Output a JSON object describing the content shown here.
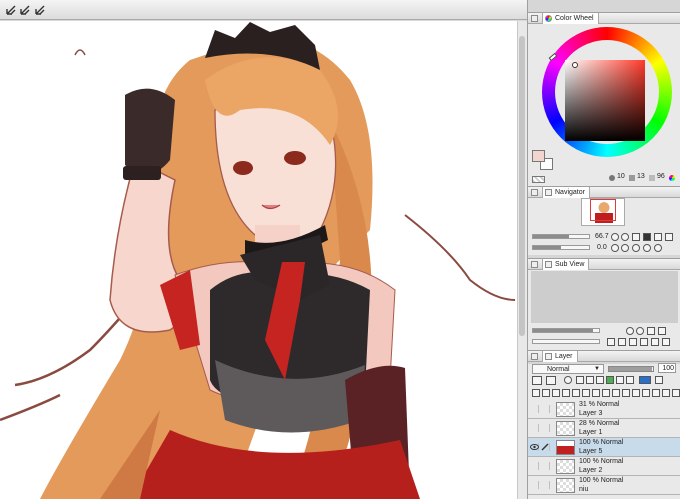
{
  "toolbar": {
    "buttons": [
      "arrow-icon",
      "arrow-icon",
      "arrow-icon"
    ]
  },
  "colors": {
    "main": "#f3d5cf",
    "sub": "#ffffff",
    "readout": {
      "h": "10",
      "s": "13",
      "v": "96"
    }
  },
  "panels": {
    "color_wheel": "Color Wheel",
    "navigator": "Navigator",
    "sub_view": "Sub View",
    "layer": "Layer"
  },
  "navigator": {
    "zoom": "66.7",
    "rotation": "0.0"
  },
  "layer_panel": {
    "blend_mode": "Normal",
    "opacity": "100",
    "layers": [
      {
        "mode": "31 % Normal",
        "name": "Layer 3",
        "selected": false,
        "visible": false,
        "color": "none"
      },
      {
        "mode": "28 % Normal",
        "name": "Layer 1",
        "selected": false,
        "visible": false,
        "color": "none"
      },
      {
        "mode": "100 % Normal",
        "name": "Layer 5",
        "selected": true,
        "visible": true,
        "color": "red"
      },
      {
        "mode": "100 % Normal",
        "name": "Layer 2",
        "selected": false,
        "visible": false,
        "color": "none"
      },
      {
        "mode": "100 % Normal",
        "name": "niu",
        "selected": false,
        "visible": false,
        "color": "none"
      }
    ]
  }
}
